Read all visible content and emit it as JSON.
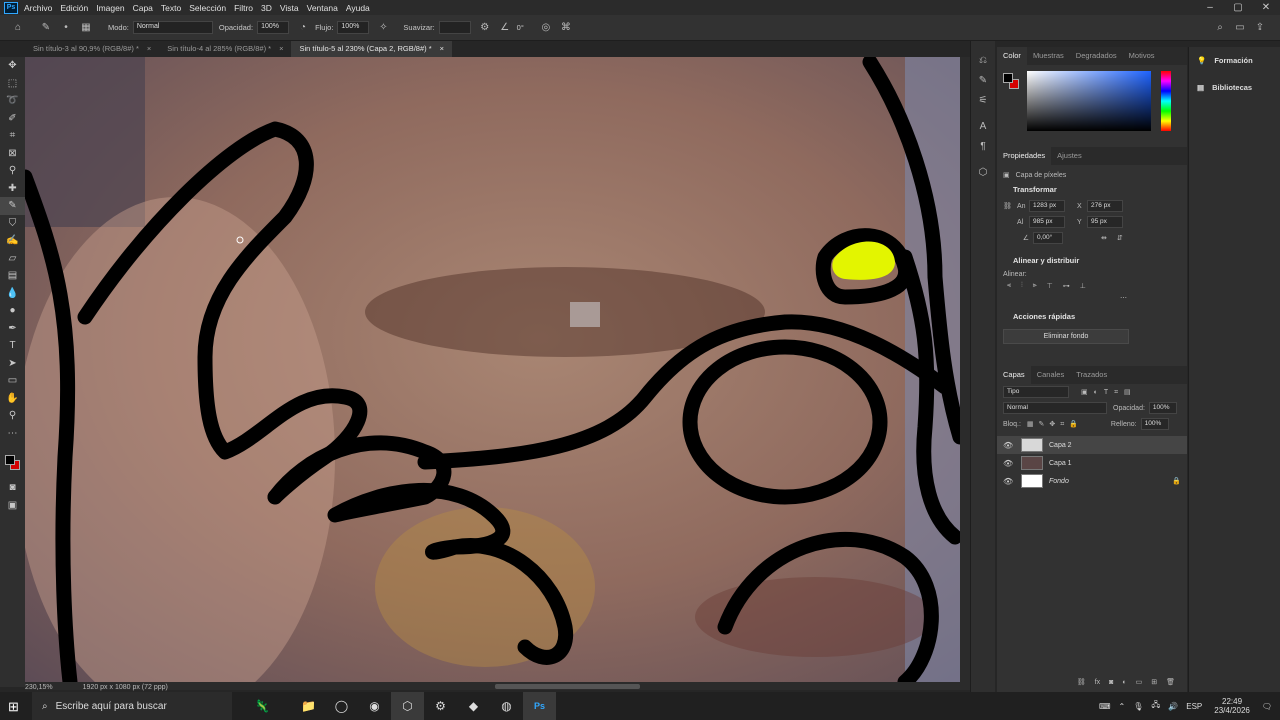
{
  "menubar": {
    "items": [
      "Archivo",
      "Edición",
      "Imagen",
      "Capa",
      "Texto",
      "Selección",
      "Filtro",
      "3D",
      "Vista",
      "Ventana",
      "Ayuda"
    ],
    "logo": "Ps"
  },
  "options": {
    "mode_label": "Modo:",
    "mode_value": "Normal",
    "opacity_label": "Opacidad:",
    "opacity_value": "100%",
    "flow_label": "Flujo:",
    "flow_value": "100%",
    "smooth_label": "Suavizar:",
    "angle_value": "0°"
  },
  "tabs": [
    {
      "label": "Sin título-3 al 90,9% (RGB/8#) *",
      "active": false
    },
    {
      "label": "Sin título-4 al 285% (RGB/8#) *",
      "active": false
    },
    {
      "label": "Sin título-5 al 230% (Capa 2, RGB/8#) *",
      "active": true
    }
  ],
  "status": {
    "zoom": "230,15%",
    "doc_size": "1920 px x 1080 px (72 ppp)"
  },
  "color_panel": {
    "tabs": [
      "Color",
      "Muestras",
      "Degradados",
      "Motivos"
    ],
    "fg": "#000000",
    "bg": "#d50000"
  },
  "properties": {
    "tabs": [
      "Propiedades",
      "Ajustes"
    ],
    "kind": "Capa de píxeles",
    "transform_title": "Transformar",
    "w_label": "An",
    "w_value": "1283 px",
    "h_label": "Al",
    "h_value": "985 px",
    "x_label": "X",
    "x_value": "276 px",
    "y_label": "Y",
    "y_value": "95 px",
    "angle_value": "0,00°",
    "align_title": "Alinear y distribuir",
    "align_label": "Alinear:",
    "quick_title": "Acciones rápidas",
    "remove_bg": "Eliminar fondo"
  },
  "layers": {
    "tabs": [
      "Capas",
      "Canales",
      "Trazados"
    ],
    "filter": "Tipo",
    "blend": "Normal",
    "opacity_label": "Opacidad:",
    "opacity_value": "100%",
    "lock_label": "Bloq.:",
    "fill_label": "Relleno:",
    "fill_value": "100%",
    "items": [
      {
        "name": "Capa 2",
        "selected": true
      },
      {
        "name": "Capa 1",
        "selected": false
      },
      {
        "name": "Fondo",
        "selected": false
      }
    ]
  },
  "right_panel": {
    "items": [
      "Formación",
      "Bibliotecas"
    ]
  },
  "taskbar": {
    "search_placeholder": "Escribe aquí para buscar",
    "lang": "ESP",
    "time": "22:49",
    "date": "23/4/2026"
  },
  "accent_colors": {
    "highlight": "#e3f500",
    "ps_blue": "#31a8ff"
  }
}
